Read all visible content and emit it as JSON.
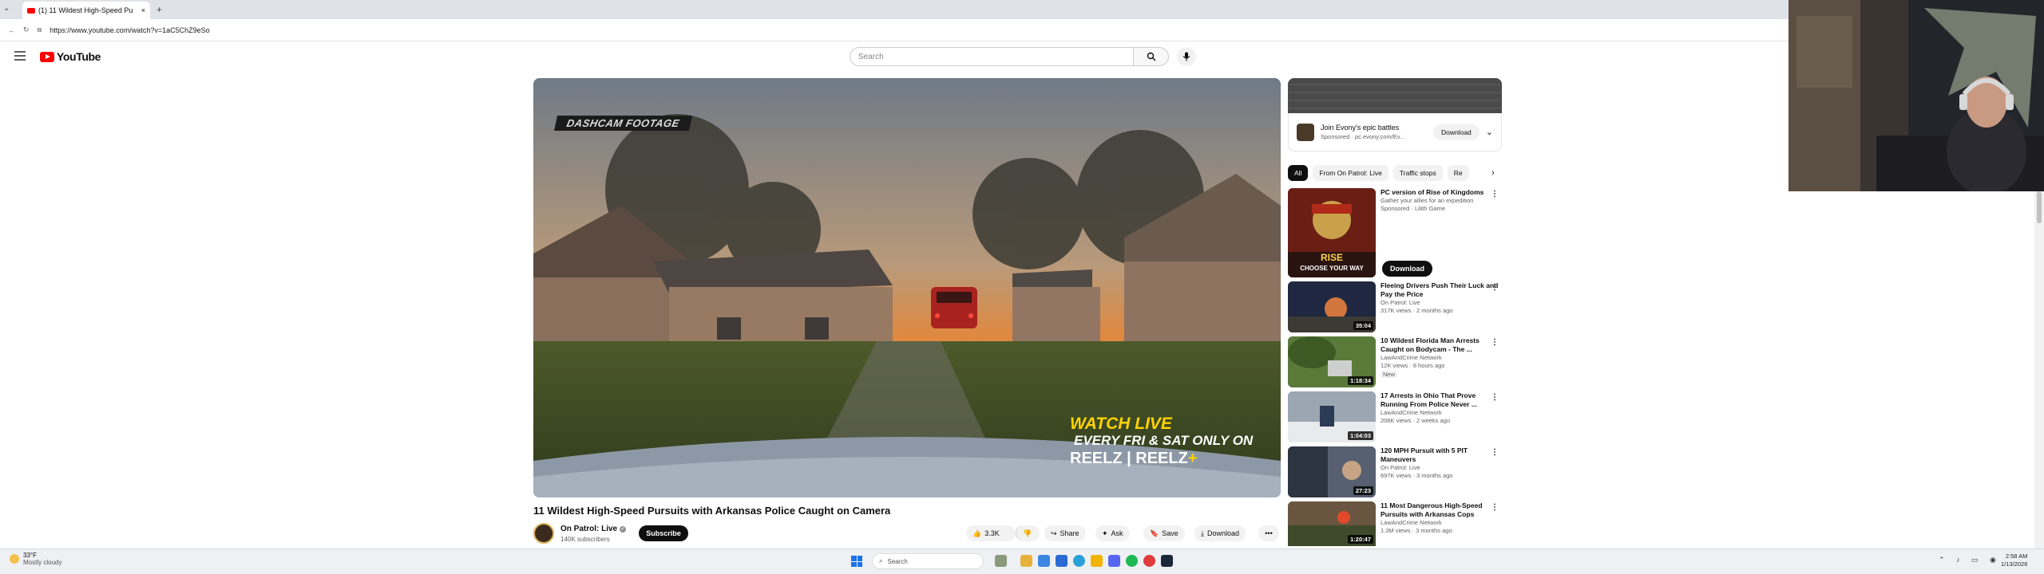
{
  "browser": {
    "tab_title": "(1) 11 Wildest High-Speed Pu",
    "new_tab_label": "+",
    "close_label": "×",
    "url": "https://www.youtube.com/watch?v=1aC5ChZ9eSo"
  },
  "masthead": {
    "logo_text": "YouTube",
    "search_placeholder": "Search"
  },
  "player": {
    "overlay_tag": "DASHCAM FOOTAGE",
    "promo_line1": "WATCH LIVE",
    "promo_line2": "EVERY FRI & SAT ONLY ON",
    "promo_brand": "REELZ | REELZ",
    "promo_plus": "+"
  },
  "video": {
    "title": "11 Wildest High-Speed Pursuits with Arkansas Police Caught on Camera",
    "channel": "On Patrol: Live",
    "subscribers": "140K subscribers",
    "subscribe_label": "Subscribe",
    "likes": "3.3K",
    "share_label": "Share",
    "ask_label": "Ask",
    "save_label": "Save",
    "download_label": "Download",
    "more_label": "•••"
  },
  "sidebar": {
    "ad": {
      "title": "Join Evony's epic battles",
      "sponsor": "Sponsored · pc.evony.com/Ev...",
      "download_label": "Download"
    },
    "chips": [
      "All",
      "From On Patrol: Live",
      "Traffic stops",
      "Re"
    ],
    "promo": {
      "title": "PC version of Rise of Kingdoms",
      "subtitle": "Gather your allies for an expedition",
      "sponsor": "Sponsored · Lilith Game",
      "thumb_text1": "RISE",
      "thumb_text2": "CHOOSE YOUR WAY",
      "download_label": "Download"
    },
    "recommendations": [
      {
        "title": "Fleeing Drivers Push Their Luck and Pay the Price",
        "channel": "On Patrol: Live",
        "meta": "317K views · 2 months ago",
        "duration": "35:04",
        "badge": ""
      },
      {
        "title": "10 Wildest Florida Man Arrests Caught on Bodycam - The ...",
        "channel": "LawAndCrime Network",
        "meta": "12K views · 8 hours ago",
        "duration": "1:18:34",
        "badge": "New"
      },
      {
        "title": "17 Arrests in Ohio That Prove Running From Police Never ...",
        "channel": "LawAndCrime Network",
        "meta": "206K views · 2 weeks ago",
        "duration": "1:04:03",
        "badge": ""
      },
      {
        "title": "120 MPH Pursuit with 5 PIT Maneuvers",
        "channel": "On Patrol: Live",
        "meta": "697K views · 3 months ago",
        "duration": "27:23",
        "badge": ""
      },
      {
        "title": "11 Most Dangerous High-Speed Pursuits with Arkansas Cops",
        "channel": "LawAndCrime Network",
        "meta": "1.3M views · 3 months ago",
        "duration": "1:20:47",
        "badge": ""
      }
    ]
  },
  "taskbar": {
    "weather_temp": "33°F",
    "weather_desc": "Mostly cloudy",
    "search_label": "Search",
    "time": "2:58 AM",
    "date": "1/13/2026"
  },
  "colors": {
    "youtube_red": "#ff0000",
    "subscribe_bg": "#0f0f0f",
    "promo_yellow": "#ffd400"
  }
}
